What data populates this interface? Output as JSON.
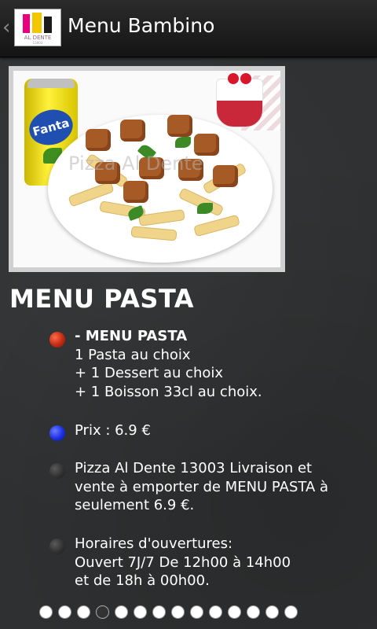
{
  "header": {
    "back_glyph": "‹",
    "title": "Menu Bambino",
    "logo": {
      "line1": "AL DENTE",
      "line2": "13003"
    }
  },
  "photo": {
    "watermark": "Pizza Al Dente",
    "can_brand": "Fanta"
  },
  "heading": "MENU PASTA",
  "items": [
    {
      "bullet_color": "#c22a10",
      "lines": [
        "- MENU PASTA",
        "1 Pasta au choix",
        "+ 1 Dessert au choix",
        "+ 1 Boisson 33cl au choix."
      ]
    },
    {
      "bullet_color": "#1b2fe0",
      "lines": [
        "Prix : 6.9 €"
      ]
    },
    {
      "bullet_color": "#323232",
      "lines": [
        "Pizza Al Dente 13003 Livraison et",
        "vente à emporter de MENU PASTA à",
        "seulement 6.9 €."
      ]
    },
    {
      "bullet_color": "#323232",
      "lines": [
        "Horaires d'ouvertures:",
        "Ouvert 7J/7 De 12h00 à 14h00",
        "et de 18h à 00h00."
      ]
    }
  ],
  "pager": {
    "total": 14,
    "active_index": 4
  }
}
